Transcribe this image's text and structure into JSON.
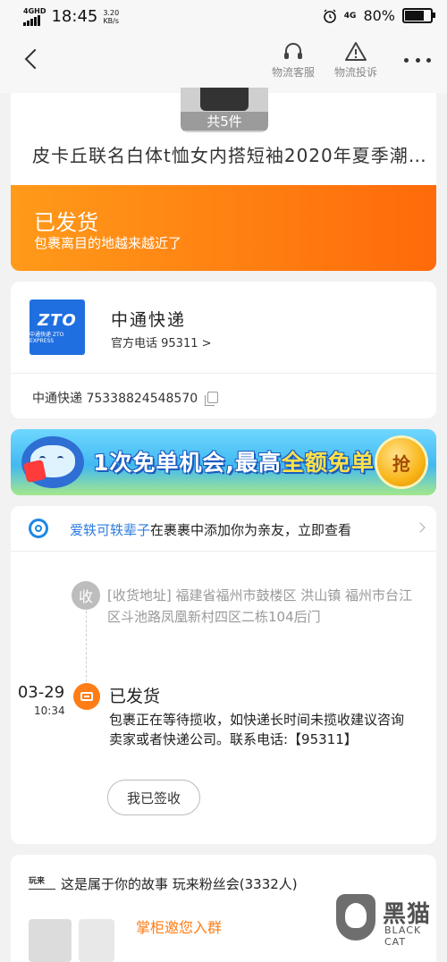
{
  "status_bar": {
    "network": "4GHD",
    "time": "18:45",
    "speed_value": "3.20",
    "speed_unit": "KB/s",
    "right_network": "4G",
    "battery": "80%",
    "battery_level": 0.8
  },
  "nav": {
    "service_label": "物流客服",
    "complaint_label": "物流投诉"
  },
  "product": {
    "count_label": "共5件",
    "title": "皮卡丘联名白体t恤女内搭短袖2020年夏季潮…"
  },
  "status": {
    "title": "已发货",
    "subtitle": "包裹离目的地越来越近了"
  },
  "courier": {
    "logo_mark": "ZTO",
    "logo_sub": "中通快递 ZTO EXPRESS",
    "name": "中通快递",
    "phone_label": "官方电话 95311 >",
    "tracking_label": "中通快递 75338824548570"
  },
  "promo": {
    "text_part1": "1次免单机会,最高",
    "text_highlight": "全额免单",
    "grab_label": "抢"
  },
  "notice": {
    "user": "爱轶可轶辈子",
    "text": "在裹裹中添加你为亲友，立即查看"
  },
  "timeline": {
    "receive_badge": "收",
    "receive_address": "[收货地址] 福建省福州市鼓楼区 洪山镇  福州市台江区斗池路凤凰新村四区二栋104后门",
    "date": "03-29",
    "time": "10:34",
    "ship_title": "已发货",
    "ship_desc": "包裹正在等待揽收，如快递长时间未揽收建议咨询卖家或者快递公司。联系电话:【95311】",
    "signed_button": "我已签收"
  },
  "fan": {
    "logo_text": "玩来",
    "text": "这是属于你的故事 玩来粉丝会(3332人)",
    "invite": "掌柜邀您入群"
  },
  "watermark": {
    "text": "黑猫",
    "sub": "BLACK CAT"
  },
  "colors": {
    "orange": "#ff7d16",
    "blue_link": "#2f7de1",
    "zto_blue": "#1f6fe0"
  }
}
